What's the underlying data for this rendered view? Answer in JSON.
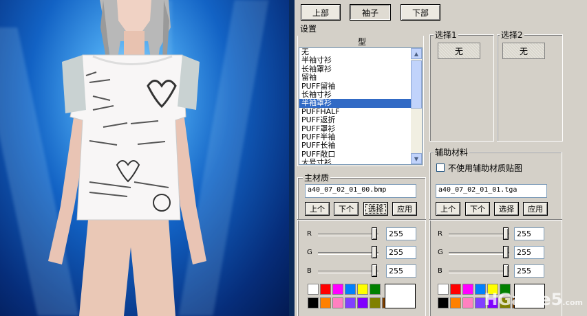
{
  "tabs": [
    {
      "label": "上部",
      "selected": false
    },
    {
      "label": "袖子",
      "selected": true
    },
    {
      "label": "下部",
      "selected": false
    }
  ],
  "settings_label": "设置",
  "type_header": "型",
  "type_list": [
    "无",
    "半袖寸衫",
    "长袖罩衫",
    "留袖",
    "PUFF留袖",
    "长袖寸衫",
    "半袖罩衫",
    "PUFFHALF",
    "PUFF返折",
    "PUFF罩衫",
    "PUFF半袖",
    "PUFF长袖",
    "PUFF敞口",
    "大号寸衫"
  ],
  "type_selected_index": 6,
  "choice1": {
    "label": "选择1",
    "value": "无"
  },
  "choice2": {
    "label": "选择2",
    "value": "无"
  },
  "main_material": {
    "label": "主材质",
    "file": "a40_07_02_01_00.bmp",
    "buttons": {
      "prev": "上个",
      "next": "下个",
      "select": "选择",
      "apply": "应用"
    },
    "rgb": {
      "R": 255,
      "G": 255,
      "B": 255
    }
  },
  "aux_material": {
    "label": "辅助材料",
    "checkbox_label": "不使用辅助材质贴图",
    "checkbox_checked": false,
    "file": "a40_07_02_01_01.tga",
    "buttons": {
      "prev": "上个",
      "next": "下个",
      "select": "选择",
      "apply": "应用"
    },
    "rgb": {
      "R": 255,
      "G": 255,
      "B": 255
    }
  },
  "palette_colors": [
    "#ffffff",
    "#ff0000",
    "#ff00ff",
    "#0080ff",
    "#ffff00",
    "#008000",
    "#000000",
    "#ff8000",
    "#ff80c0",
    "#8040ff",
    "#8000ff",
    "#808000",
    "#804000"
  ],
  "preview_color": "#ffffff",
  "watermark": {
    "main": "HGame5",
    "suffix": ".com"
  }
}
